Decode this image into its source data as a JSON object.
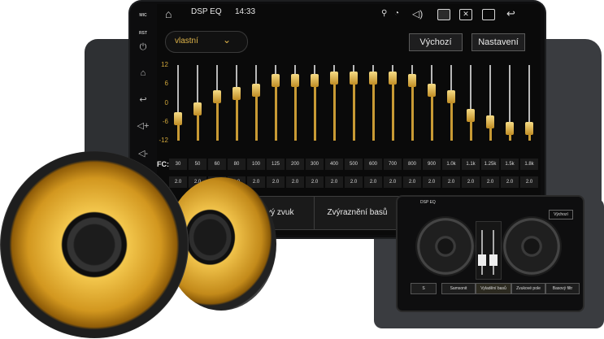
{
  "status_bar": {
    "title": "DSP EQ",
    "time": "14:33",
    "icons": [
      "home-icon",
      "location-icon",
      "wifi-icon",
      "volume-icon",
      "screenshot-icon",
      "close-window-icon",
      "windows-icon",
      "back-icon"
    ]
  },
  "side_keys": {
    "mic": "MIC",
    "rst": "RST",
    "icons": [
      "power-icon",
      "home-icon",
      "back-icon",
      "volume-up-icon",
      "volume-down-icon"
    ]
  },
  "preset": {
    "label": "vlastní",
    "icon": "chevron-down-icon"
  },
  "buttons": {
    "default": "Výchozí",
    "settings": "Nastavení"
  },
  "eq": {
    "y_ticks": [
      "12",
      "6",
      "0",
      "-6",
      "-12"
    ],
    "fc_label": "FC:",
    "frequencies": [
      "30",
      "50",
      "60",
      "80",
      "100",
      "125",
      "200",
      "300",
      "400",
      "500",
      "600",
      "700",
      "800",
      "900",
      "1.0k",
      "1.1k",
      "1.25k",
      "1.5k",
      "1.8k"
    ],
    "q_values": [
      "2.0",
      "2.0",
      "2.0",
      "2.0",
      "2.0",
      "2.0",
      "2.0",
      "2.0",
      "2.0",
      "2.0",
      "2.0",
      "2.0",
      "2.0",
      "2.0",
      "2.0",
      "2.0",
      "2.0",
      "2.0",
      "2.0"
    ],
    "gains_db": [
      -5,
      -2,
      2,
      3,
      4,
      7,
      7,
      7,
      8,
      8,
      8,
      8,
      7,
      4,
      2,
      -4,
      -6,
      -8,
      -8
    ],
    "ylim": [
      -12,
      12
    ]
  },
  "bottom_buttons": [
    "ový zvuk",
    "Zvýraznění basů"
  ],
  "mini_preview": {
    "title": "DSP EQ",
    "default": "Výchozí",
    "buttons": [
      "Samsonit",
      "Vyladění basů",
      "Zvukové pole",
      "Basový filtr"
    ]
  },
  "colors": {
    "accent": "#d0a63b",
    "speaker_gold": "#d9a72b",
    "bezel": "#0d0d0e"
  }
}
